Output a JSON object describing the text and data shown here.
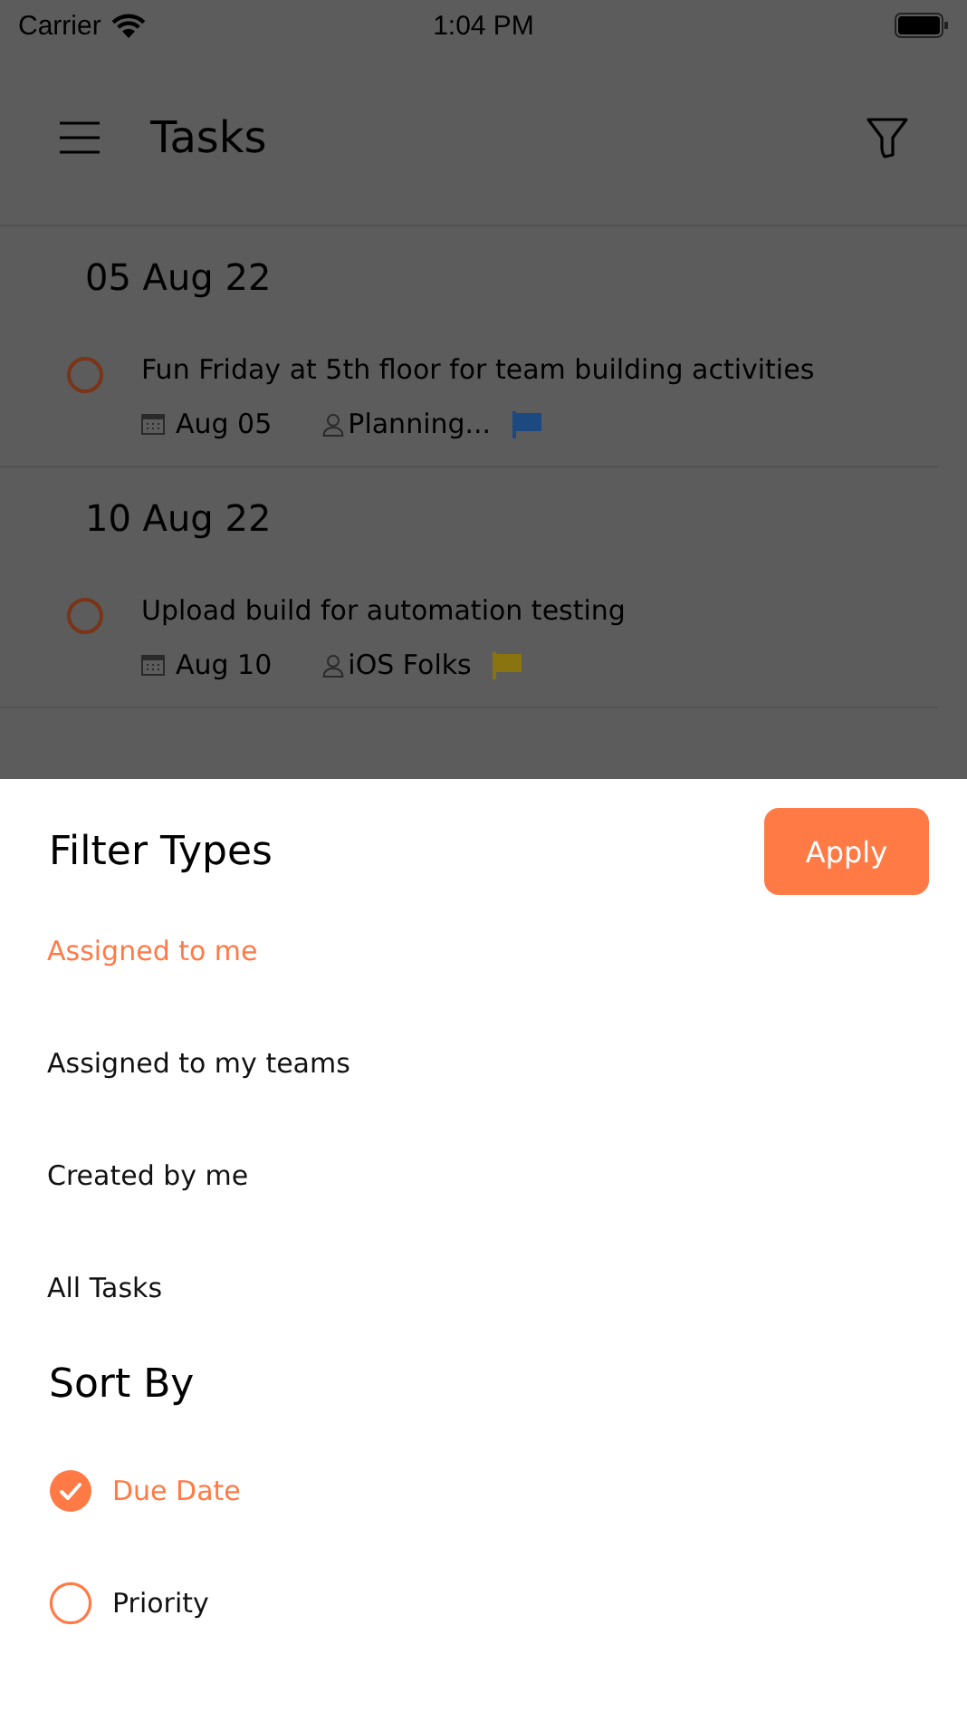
{
  "status_bar": {
    "carrier": "Carrier",
    "time": "1:04 PM"
  },
  "header": {
    "title": "Tasks"
  },
  "groups": [
    {
      "date": "05 Aug 22",
      "tasks": [
        {
          "title": "Fun Friday at 5th floor for team building activities",
          "due": "Aug 05",
          "assignee": "Planning...",
          "completed": false,
          "color": "#1c4a80"
        }
      ]
    },
    {
      "date": "10 Aug 22",
      "tasks": [
        {
          "title": "Upload build for automation testing",
          "due": "Aug 10",
          "assignee": "iOS Folks",
          "completed": false,
          "color": "#8a7410"
        }
      ]
    }
  ],
  "sheet": {
    "filter_title": "Filter Types",
    "apply": "Apply",
    "filters": [
      {
        "label": "Assigned to me",
        "selected": true
      },
      {
        "label": "Assigned to my teams",
        "selected": false
      },
      {
        "label": "Created by me",
        "selected": false
      },
      {
        "label": "All Tasks",
        "selected": false
      }
    ],
    "sort_title": "Sort By",
    "sorts": [
      {
        "label": "Due Date",
        "selected": true
      },
      {
        "label": "Priority",
        "selected": false
      }
    ]
  }
}
